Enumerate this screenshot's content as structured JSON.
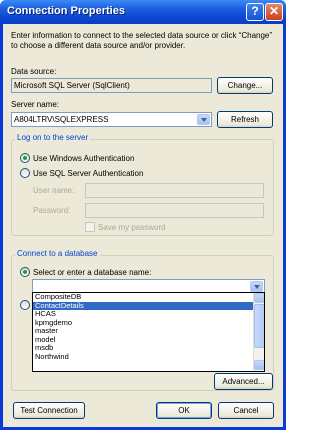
{
  "window": {
    "title": "Connection Properties",
    "help_glyph": "?",
    "close_glyph": "✕"
  },
  "intro": "Enter information to connect to the selected data source or click “Change” to choose a different data source and/or provider.",
  "data_source": {
    "label": "Data source:",
    "value": "Microsoft SQL Server (SqlClient)",
    "change_label": "Change..."
  },
  "server": {
    "label": "Server name:",
    "value": "A804LTRV\\SQLEXPRESS",
    "refresh_label": "Refresh"
  },
  "logon": {
    "group_title": "Log on to the server",
    "windows_auth": "Use Windows Authentication",
    "sql_auth": "Use SQL Server Authentication",
    "selected": "windows",
    "username_label": "User name:",
    "username_value": "",
    "password_label": "Password:",
    "password_value": "",
    "save_password": "Save my password"
  },
  "database": {
    "group_title": "Connect to a database",
    "select_label": "Select or enter a database name:",
    "input_value": "",
    "options": [
      "CompositeDB",
      "ContactDetails",
      "HCAS",
      "kpmgdemo",
      "master",
      "model",
      "msdb",
      "Northwind"
    ],
    "highlighted": "ContactDetails"
  },
  "buttons": {
    "advanced": "Advanced...",
    "test": "Test Connection",
    "ok": "OK",
    "cancel": "Cancel"
  }
}
